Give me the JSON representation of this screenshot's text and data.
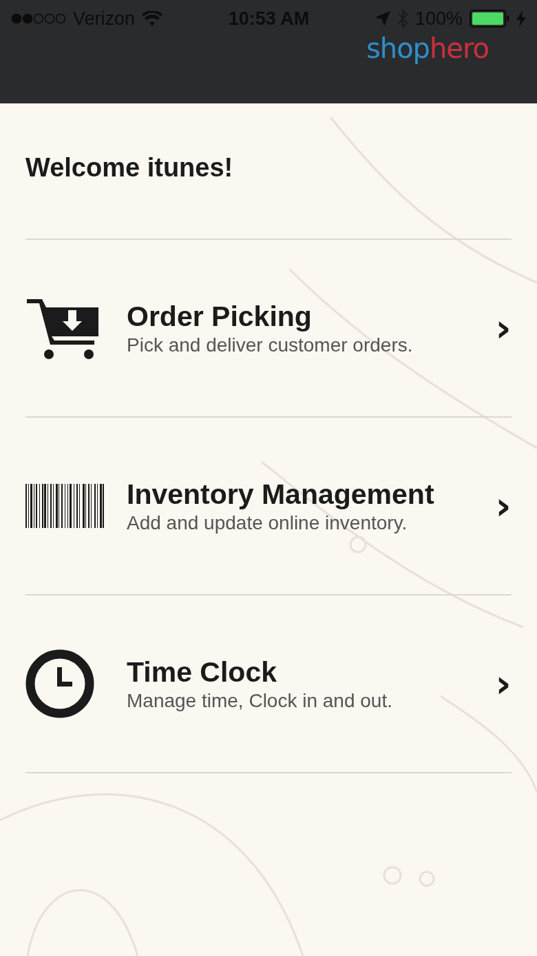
{
  "status_bar": {
    "carrier": "Verizon",
    "time": "10:53 AM",
    "battery": "100%"
  },
  "logo": [
    "shop",
    "hero"
  ],
  "welcome": "Welcome itunes!",
  "menu": [
    {
      "kind": "cart",
      "title": "Order Picking",
      "subtitle": "Pick and deliver customer orders.",
      "chevron": "›"
    },
    {
      "kind": "barcode",
      "title": "Inventory Management",
      "subtitle": "Add and update online inventory.",
      "chevron": "›"
    },
    {
      "kind": "clock",
      "title": "Time Clock",
      "subtitle": "Manage time, Clock in and out.",
      "chevron": "›"
    }
  ]
}
